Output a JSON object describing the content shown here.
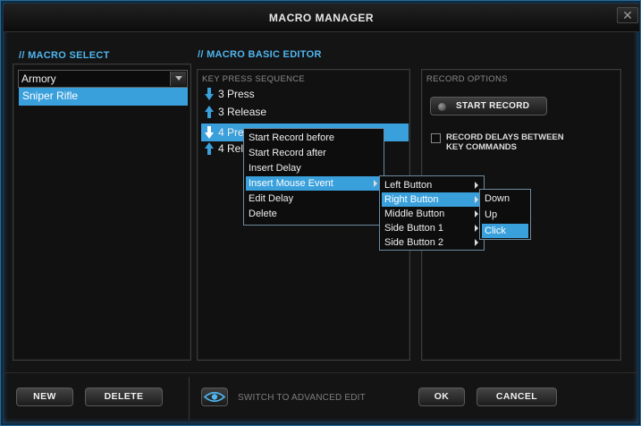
{
  "window": {
    "title": "MACRO MANAGER",
    "close_glyph": "✕"
  },
  "macro_select": {
    "heading": "// MACRO SELECT",
    "dropdown_value": "Armory",
    "items": [
      "Sniper Rifle"
    ]
  },
  "editor": {
    "heading": "// MACRO BASIC EDITOR",
    "sequence_header": "KEY PRESS SEQUENCE",
    "rows": [
      {
        "label": "3 Press",
        "direction": "down",
        "selected": false
      },
      {
        "label": "3 Release",
        "direction": "up",
        "selected": false
      },
      {
        "label": "4 Pre",
        "direction": "down",
        "selected": true
      },
      {
        "label": "4 Rel",
        "direction": "up",
        "selected": false
      }
    ]
  },
  "record_options": {
    "header": "RECORD OPTIONS",
    "start_label": "START RECORD",
    "delay_checkbox_label": "RECORD DELAYS BETWEEN KEY COMMANDS",
    "delay_checked": false
  },
  "context_menu": {
    "items": [
      "Start Record before",
      "Start Record after",
      "Insert Delay",
      "Insert Mouse Event",
      "Edit Delay",
      "Delete"
    ],
    "active_index": 3
  },
  "mouse_menu": {
    "items": [
      "Left Button",
      "Right Button",
      "Middle Button",
      "Side Button 1",
      "Side Button 2"
    ],
    "active_index": 1
  },
  "action_menu": {
    "items": [
      "Down",
      "Up",
      "Click"
    ],
    "active_index": 2
  },
  "bottom": {
    "new_label": "NEW",
    "delete_label": "DELETE",
    "advanced_label": "SWITCH TO ADVANCED EDIT",
    "ok_label": "OK",
    "cancel_label": "CANCEL"
  },
  "colors": {
    "accent": "#3aa0dc",
    "heading": "#4fb6ee",
    "background": "#141414"
  },
  "icons": {
    "close": "close-icon",
    "eye": "eye-icon",
    "arrow_down": "arrow-down-icon",
    "arrow_up": "arrow-up-icon"
  }
}
